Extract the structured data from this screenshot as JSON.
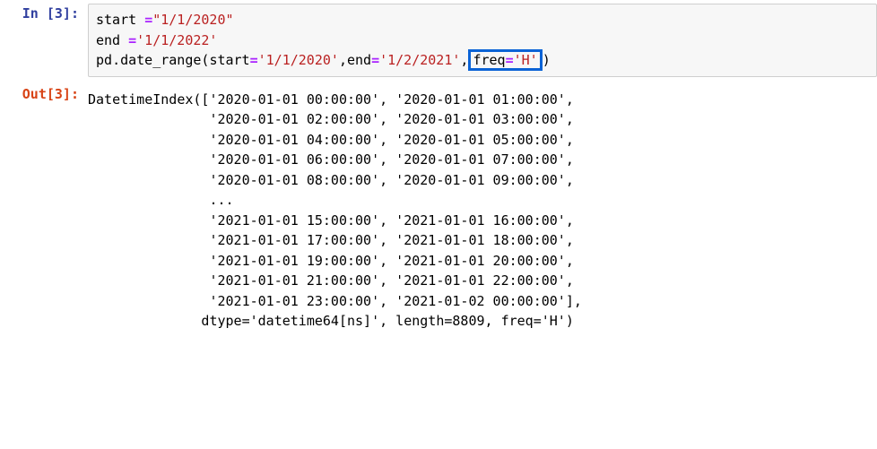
{
  "cell": {
    "in_prompt": "In [3]:",
    "out_prompt": "Out[3]:",
    "code": {
      "line1_var": "start ",
      "line1_eq": "=",
      "line1_val": "\"1/1/2020\"",
      "line2_var": "end ",
      "line2_eq": "=",
      "line2_val": "'1/1/2022'",
      "line3_pre": "pd",
      "line3_dot": ".",
      "line3_func": "date_range",
      "line3_open": "(",
      "line3_kw1": "start",
      "line3_eq1": "=",
      "line3_str1": "'1/1/2020'",
      "line3_comma1": ",",
      "line3_kw2": "end",
      "line3_eq2": "=",
      "line3_str2": "'1/2/2021'",
      "line3_comma2": ",",
      "line3_kw3": "freq",
      "line3_eq3": "=",
      "line3_str3": "'H'",
      "line3_close": ")"
    },
    "output": "DatetimeIndex(['2020-01-01 00:00:00', '2020-01-01 01:00:00',\n               '2020-01-01 02:00:00', '2020-01-01 03:00:00',\n               '2020-01-01 04:00:00', '2020-01-01 05:00:00',\n               '2020-01-01 06:00:00', '2020-01-01 07:00:00',\n               '2020-01-01 08:00:00', '2020-01-01 09:00:00',\n               ...\n               '2021-01-01 15:00:00', '2021-01-01 16:00:00',\n               '2021-01-01 17:00:00', '2021-01-01 18:00:00',\n               '2021-01-01 19:00:00', '2021-01-01 20:00:00',\n               '2021-01-01 21:00:00', '2021-01-01 22:00:00',\n               '2021-01-01 23:00:00', '2021-01-02 00:00:00'],\n              dtype='datetime64[ns]', length=8809, freq='H')"
  }
}
